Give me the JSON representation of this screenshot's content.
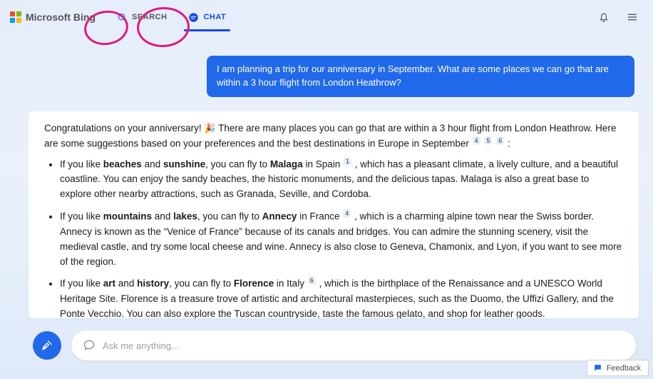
{
  "brand": {
    "name": "Microsoft Bing"
  },
  "tabs": {
    "search": {
      "label": "SEARCH"
    },
    "chat": {
      "label": "CHAT"
    }
  },
  "conversation": {
    "user_message": "I am planning a trip for our anniversary in September. What are some places we can go that are within a 3 hour flight from London Heathrow?",
    "bot": {
      "intro_pre": "Congratulations on your anniversary! ",
      "intro_post": " There are many places you can go that are within a 3 hour flight from London Heathrow. Here are some suggestions based on your preferences and the best destinations in Europe in September",
      "intro_cites": [
        "4",
        "5",
        "6"
      ],
      "colon": " :",
      "items": [
        {
          "lead": "If you like ",
          "kw1": "beaches",
          "mid1": " and ",
          "kw2": "sunshine",
          "mid2": ", you can fly to ",
          "dest": "Malaga",
          "loc": " in Spain",
          "cite": "1",
          "rest": " , which has a pleasant climate, a lively culture, and a beautiful coastline. You can enjoy the sandy beaches, the historic monuments, and the delicious tapas. Malaga is also a great base to explore other nearby attractions, such as Granada, Seville, and Cordoba."
        },
        {
          "lead": "If you like ",
          "kw1": "mountains",
          "mid1": " and ",
          "kw2": "lakes",
          "mid2": ", you can fly to ",
          "dest": "Annecy",
          "loc": " in France",
          "cite": "4",
          "rest": " , which is a charming alpine town near the Swiss border. Annecy is known as the “Venice of France” because of its canals and bridges. You can admire the stunning scenery, visit the medieval castle, and try some local cheese and wine. Annecy is also close to Geneva, Chamonix, and Lyon, if you want to see more of the region."
        },
        {
          "lead": "If you like ",
          "kw1": "art",
          "mid1": " and ",
          "kw2": "history",
          "mid2": ", you can fly to ",
          "dest": "Florence",
          "loc": " in Italy",
          "cite": "6",
          "rest": " , which is the birthplace of the Renaissance and a UNESCO World Heritage Site. Florence is a treasure trove of artistic and architectural masterpieces, such as the Duomo, the Uffizi Gallery, and the Ponte Vecchio. You can also explore the Tuscan countryside, taste the famous gelato, and shop for leather goods."
        }
      ]
    }
  },
  "input": {
    "placeholder": "Ask me anything..."
  },
  "feedback": {
    "label": "Feedback"
  }
}
